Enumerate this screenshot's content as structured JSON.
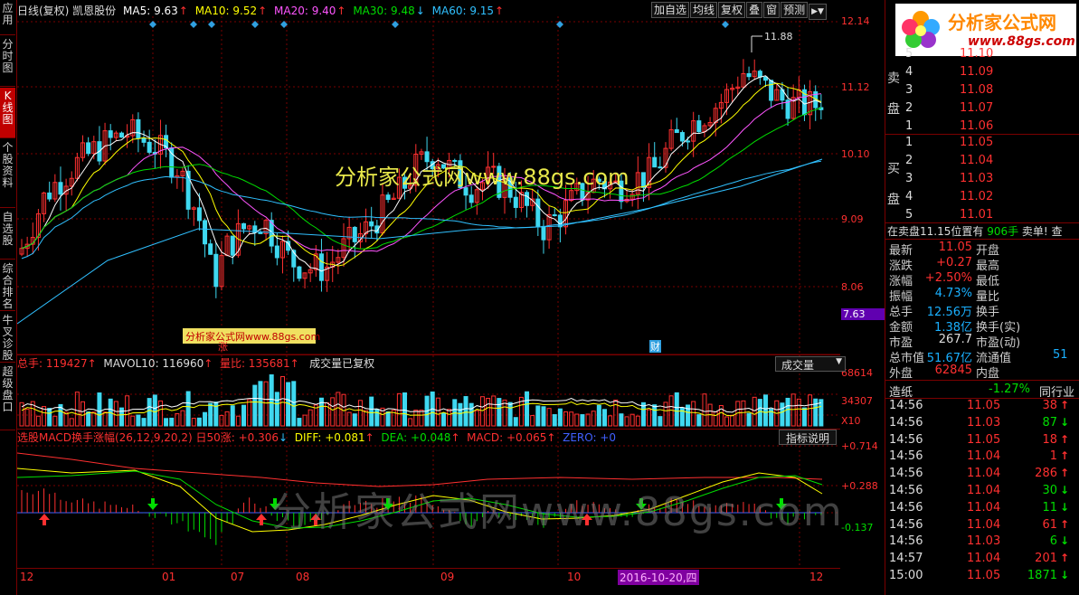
{
  "left_tabs": [
    {
      "label": "应用"
    },
    {
      "label": "分时图"
    },
    {
      "label": "K线图",
      "active": true
    },
    {
      "label": "个股资料"
    },
    {
      "label": "自选股"
    },
    {
      "label": "综合排名"
    },
    {
      "label": "牛叉诊股"
    },
    {
      "label": "超级盘口"
    }
  ],
  "header": {
    "title": "日线(复权) 凯恩股份",
    "ma5": "MA5: 9.63",
    "ma10": "MA10: 9.52",
    "ma20": "MA20: 9.40",
    "ma30": "MA30: 9.48",
    "ma60": "MA60: 9.15",
    "colors": {
      "ma5": "#ffffff",
      "ma10": "#ffff00",
      "ma20": "#ff55ff",
      "ma30": "#00dd00",
      "ma60": "#30c0ff"
    }
  },
  "toolbar": {
    "buttons": [
      "加自选",
      "均线",
      "复权",
      "叠",
      "窗",
      "预测"
    ],
    "menu_icon": "menu-arrow-icon"
  },
  "price_axis": [
    "12.14",
    "11.12",
    "10.10",
    "9.09",
    "8.06",
    "7.63"
  ],
  "price_axis_current": "7.63",
  "high_marker": "11.88",
  "markers": {
    "zhang": "涨",
    "cai": "财"
  },
  "watermark_main": "分析家公式网www.88gs.com",
  "watermark_small": "分析家公式网www.88gs.com",
  "watermark_bottom": "分析家公式网www.88gs.com",
  "volume": {
    "title": "总手: 119427",
    "mavol": "MAVOL10: 116960",
    "ratio": "量比: 135681",
    "note": "成交量已复权",
    "dropdown": "成交量",
    "axis": [
      "68614",
      "34307",
      "X10"
    ]
  },
  "macd": {
    "title": "选股MACD换手涨幅(26,12,9,20,2) 日50涨: +0.306",
    "diff": "DIFF: +0.081",
    "dea": "DEA: +0.048",
    "macd": "MACD: +0.065",
    "zero": "ZERO: +0",
    "button": "指标说明",
    "axis": [
      "+0.714",
      "+0.288",
      "-0.137"
    ]
  },
  "dates": [
    "12",
    "01",
    "07",
    "08",
    "09",
    "10",
    "12"
  ],
  "date_cursor": "2016-10-20,四",
  "orderbook": {
    "logo_text": "分析家公式网",
    "logo_url": "www.88gs.com",
    "sell_label": "卖盘",
    "buy_label": "买盘",
    "sell": [
      {
        "lvl": "5",
        "price": "11.10"
      },
      {
        "lvl": "4",
        "price": "11.09"
      },
      {
        "lvl": "3",
        "price": "11.08"
      },
      {
        "lvl": "2",
        "price": "11.07"
      },
      {
        "lvl": "1",
        "price": "11.06"
      }
    ],
    "buy": [
      {
        "lvl": "1",
        "price": "11.05"
      },
      {
        "lvl": "2",
        "price": "11.04"
      },
      {
        "lvl": "3",
        "price": "11.03"
      },
      {
        "lvl": "4",
        "price": "11.02"
      },
      {
        "lvl": "5",
        "price": "11.01"
      }
    ],
    "notice": "在卖盘11.15位置有",
    "notice_vol": "906手",
    "notice_tail": "卖单! 查"
  },
  "stats": [
    {
      "k": "最新",
      "v": "11.05",
      "k2": "开盘",
      "v2": ""
    },
    {
      "k": "涨跌",
      "v": "+0.27",
      "k2": "最高",
      "v2": ""
    },
    {
      "k": "涨幅",
      "v": "+2.50%",
      "k2": "最低",
      "v2": ""
    },
    {
      "k": "振幅",
      "v": "4.73%",
      "k2": "量比",
      "v2": ""
    },
    {
      "k": "总手",
      "v": "12.56万",
      "k2": "换手",
      "v2": ""
    },
    {
      "k": "金额",
      "v": "1.38亿",
      "k2": "换手(实)",
      "v2": ""
    },
    {
      "k": "市盈",
      "v": "267.7",
      "k2": "市盈(动)",
      "v2": ""
    },
    {
      "k": "总市值",
      "v": "51.67亿",
      "k2": "流通值",
      "v2": "51"
    },
    {
      "k": "外盘",
      "v": "62845",
      "k2": "内盘",
      "v2": ""
    }
  ],
  "industry": {
    "name": "造纸",
    "change": "-1.27%",
    "tab": "同行业"
  },
  "ticks": [
    {
      "t": "14:56",
      "p": "11.05",
      "v": "38",
      "d": "up"
    },
    {
      "t": "14:56",
      "p": "11.03",
      "v": "87",
      "d": "down"
    },
    {
      "t": "14:56",
      "p": "11.05",
      "v": "18",
      "d": "up"
    },
    {
      "t": "14:56",
      "p": "11.04",
      "v": "1",
      "d": "up"
    },
    {
      "t": "14:56",
      "p": "11.04",
      "v": "286",
      "d": "up"
    },
    {
      "t": "14:56",
      "p": "11.04",
      "v": "30",
      "d": "down"
    },
    {
      "t": "14:56",
      "p": "11.04",
      "v": "11",
      "d": "down"
    },
    {
      "t": "14:56",
      "p": "11.04",
      "v": "61",
      "d": "up"
    },
    {
      "t": "14:56",
      "p": "11.03",
      "v": "6",
      "d": "down"
    },
    {
      "t": "14:57",
      "p": "11.04",
      "v": "201",
      "d": "up"
    },
    {
      "t": "15:00",
      "p": "11.05",
      "v": "1871",
      "d": "down"
    }
  ]
}
